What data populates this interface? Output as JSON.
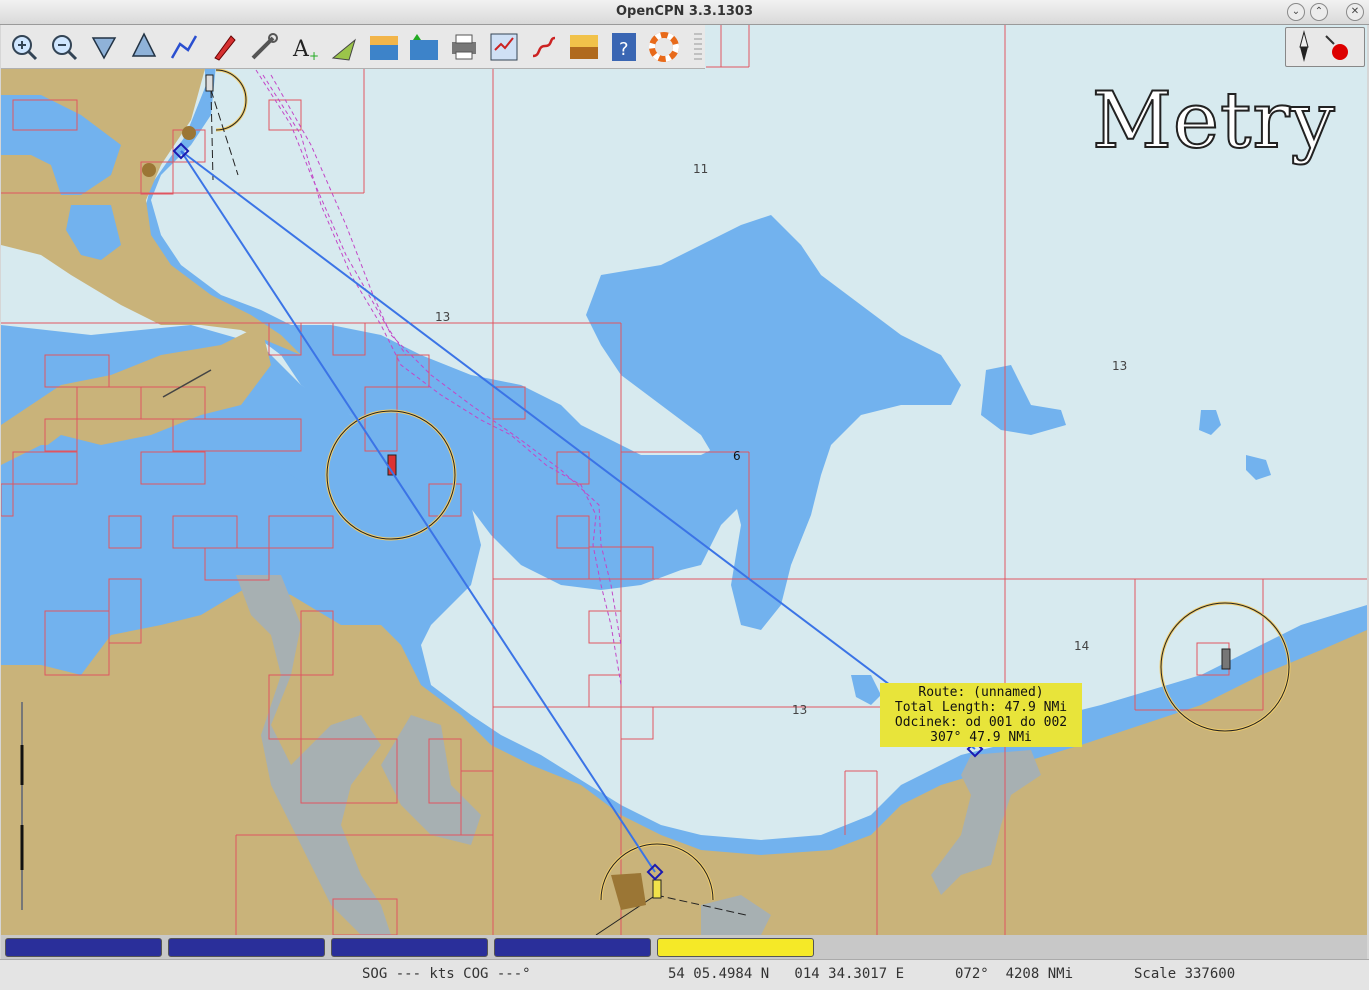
{
  "window": {
    "title": "OpenCPN 3.3.1303"
  },
  "toolbar": {
    "buttons": [
      {
        "name": "zoom-in-icon"
      },
      {
        "name": "zoom-out-icon"
      },
      {
        "name": "scale-in-icon"
      },
      {
        "name": "scale-out-icon"
      },
      {
        "name": "route-icon"
      },
      {
        "name": "follow-ship-icon"
      },
      {
        "name": "settings-icon"
      },
      {
        "name": "text-icon"
      },
      {
        "name": "ais-icon"
      },
      {
        "name": "current-icon"
      },
      {
        "name": "tide-icon"
      },
      {
        "name": "print-icon"
      },
      {
        "name": "route-manager-icon"
      },
      {
        "name": "track-icon"
      },
      {
        "name": "color-scheme-icon"
      },
      {
        "name": "help-icon"
      },
      {
        "name": "mob-icon"
      }
    ]
  },
  "chart": {
    "watermark": "Metry",
    "depths": [
      "11",
      "13",
      "6",
      "13",
      "14",
      "13"
    ],
    "tooltip": {
      "line1": "Route: (unnamed)",
      "line2": "Total Length: 47.9 NMi",
      "line3": "Odcinek: od 001 do 002",
      "line4": "307°  47.9 NMi"
    }
  },
  "piano": {
    "keys": 5,
    "selected_index": 4
  },
  "status": {
    "sog_cog": "SOG --- kts COG ---°",
    "position": "54 05.4984 N   014 34.3017 E",
    "bearing_distance": "072°  4208 NMi",
    "scale": "Scale 337600"
  },
  "colors": {
    "land": "#c9b37a",
    "shallow": "#72b2ee",
    "deep": "#d7eaef",
    "route": "#3b74e6",
    "grid": "#e05560",
    "highlight": "#f5e927"
  }
}
